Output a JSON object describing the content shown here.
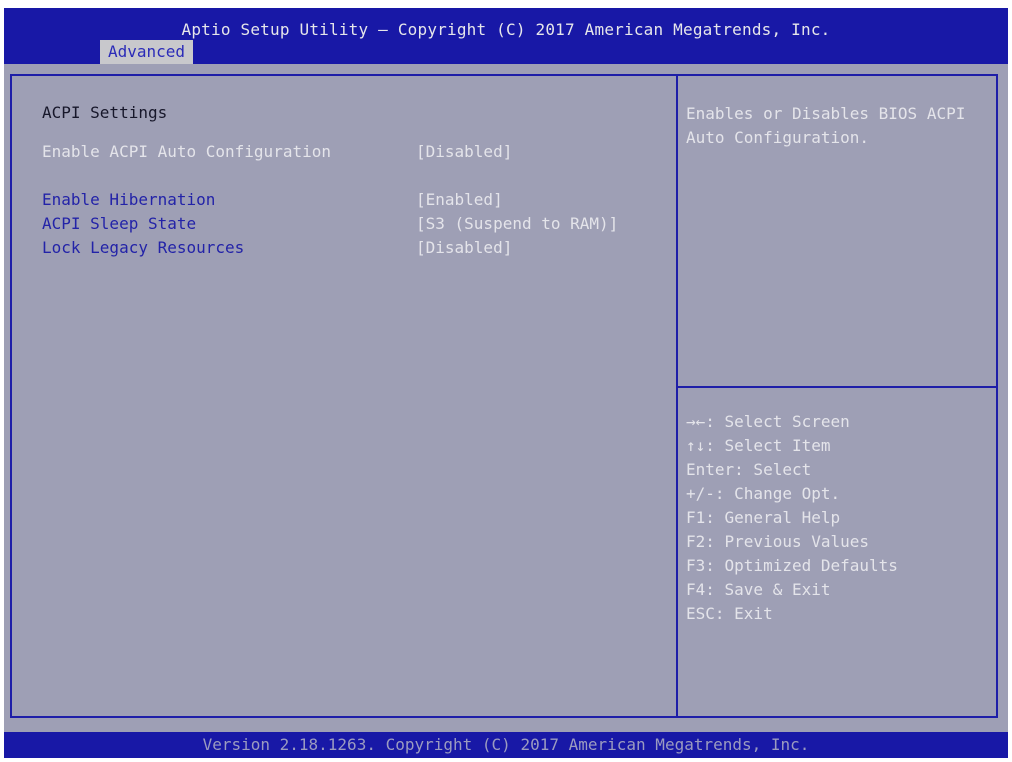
{
  "header": {
    "title": "Aptio Setup Utility – Copyright (C) 2017 American Megatrends, Inc.",
    "active_tab": "Advanced"
  },
  "main": {
    "section_title": "ACPI Settings",
    "settings": [
      {
        "label": "Enable ACPI Auto Configuration",
        "value": "[Disabled]",
        "selected": true
      },
      {
        "label": "Enable Hibernation",
        "value": "[Enabled]",
        "selected": false
      },
      {
        "label": "ACPI Sleep State",
        "value": "[S3 (Suspend to RAM)]",
        "selected": false
      },
      {
        "label": "Lock Legacy Resources",
        "value": "[Disabled]",
        "selected": false
      }
    ]
  },
  "help": {
    "text": "Enables or Disables BIOS ACPI\nAuto Configuration."
  },
  "keys": [
    "→←: Select Screen",
    "↑↓: Select Item",
    "Enter: Select",
    "+/-: Change Opt.",
    "F1: General Help",
    "F2: Previous Values",
    "F3: Optimized Defaults",
    "F4: Save & Exit",
    "ESC: Exit"
  ],
  "footer": {
    "text": "Version 2.18.1263. Copyright (C) 2017 American Megatrends, Inc."
  },
  "colors": {
    "header_bg": "#1818a6",
    "panel_bg": "#9e9fb5",
    "label_blue": "#2323a8",
    "text_light": "#e4e4ea"
  }
}
